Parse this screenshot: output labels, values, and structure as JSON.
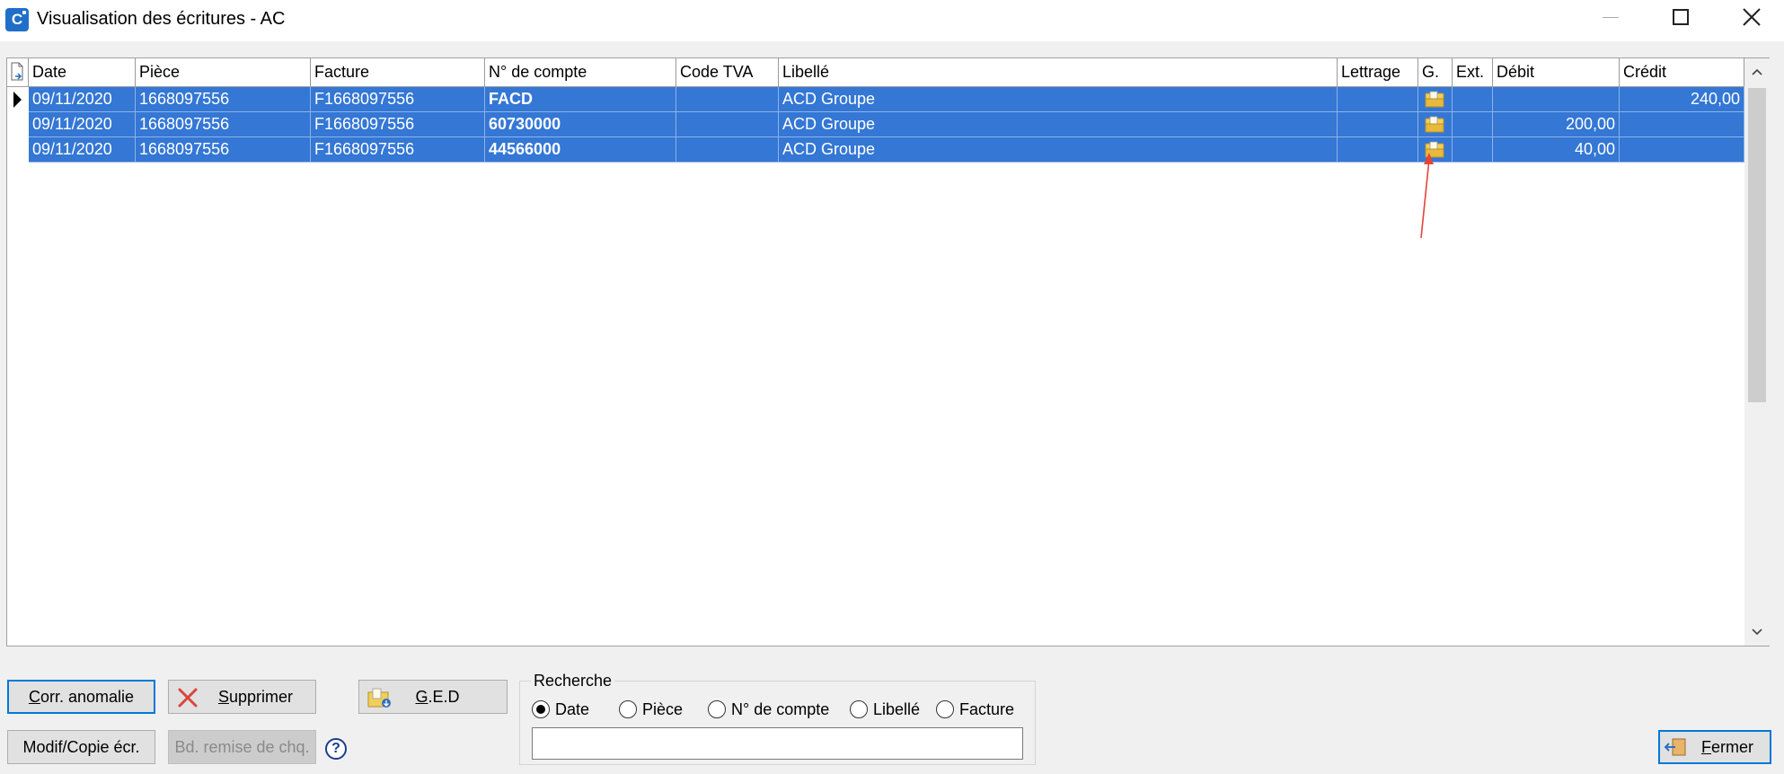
{
  "window": {
    "title": "Visualisation des écritures - AC",
    "app_icon_letter": "C"
  },
  "grid": {
    "columns": [
      "Date",
      "Pièce",
      "Facture",
      "N° de compte",
      "Code TVA",
      "Libellé",
      "Lettrage",
      "G.",
      "Ext.",
      "Débit",
      "Crédit"
    ],
    "rows": [
      {
        "date": "09/11/2020",
        "piece": "1668097556",
        "facture": "F1668097556",
        "compte": "FACD",
        "code_tva": "",
        "libelle": "ACD Groupe",
        "lettrage": "",
        "ext": "",
        "debit": "",
        "credit": "240,00"
      },
      {
        "date": "09/11/2020",
        "piece": "1668097556",
        "facture": "F1668097556",
        "compte": "60730000",
        "code_tva": "",
        "libelle": "ACD Groupe",
        "lettrage": "",
        "ext": "",
        "debit": "200,00",
        "credit": ""
      },
      {
        "date": "09/11/2020",
        "piece": "1668097556",
        "facture": "F1668097556",
        "compte": "44566000",
        "code_tva": "",
        "libelle": "ACD Groupe",
        "lettrage": "",
        "ext": "",
        "debit": "40,00",
        "credit": ""
      }
    ],
    "selected_color": "#3477d5"
  },
  "buttons": {
    "corr_anomalie": {
      "first": "C",
      "rest": "orr. anomalie"
    },
    "supprimer": {
      "first": "S",
      "rest": "upprimer"
    },
    "ged": {
      "first": "G",
      "rest": ".E.D"
    },
    "modif_copie": "Modif/Copie écr.",
    "bd_remise": "Bd. remise de chq.",
    "fermer": {
      "first": "F",
      "rest": "ermer"
    }
  },
  "help_glyph": "?",
  "search": {
    "title": "Recherche",
    "options": [
      "Date",
      "Pièce",
      "N° de compte",
      "Libellé",
      "Facture"
    ],
    "selected": "Date",
    "value": ""
  },
  "annotation_color": "#e0453a"
}
